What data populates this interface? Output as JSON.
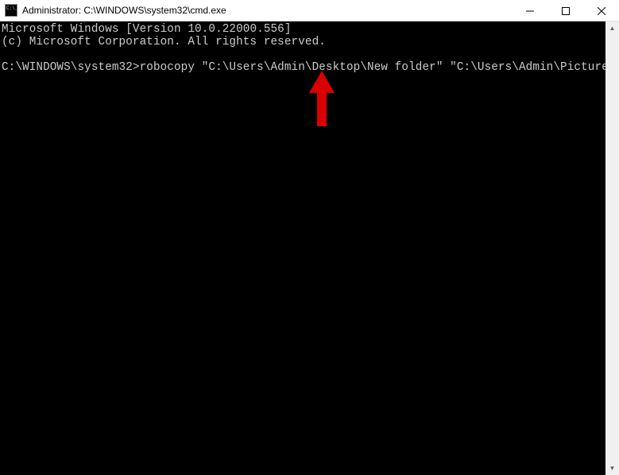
{
  "window": {
    "title": "Administrator: C:\\WINDOWS\\system32\\cmd.exe"
  },
  "terminal": {
    "line1": "Microsoft Windows [Version 10.0.22000.556]",
    "line2": "(c) Microsoft Corporation. All rights reserved.",
    "blank": "",
    "prompt": "C:\\WINDOWS\\system32>",
    "command": "robocopy \"C:\\Users\\Admin\\Desktop\\New folder\" \"C:\\Users\\Admin\\Pictures\\Copy\""
  },
  "annotation": {
    "color": "#d90000",
    "type": "up-arrow"
  }
}
